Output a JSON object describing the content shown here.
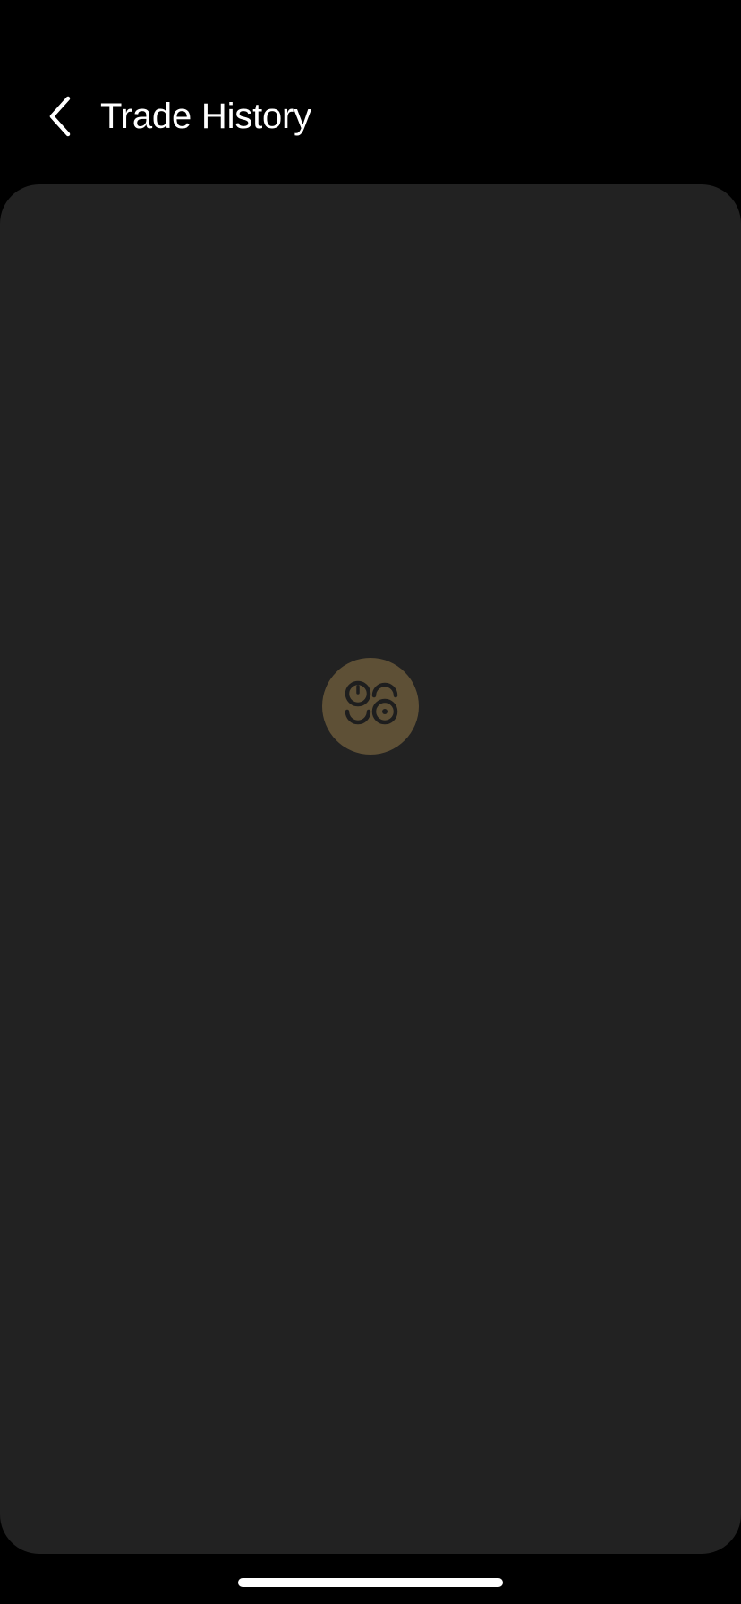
{
  "header": {
    "back_icon": "chevron-left-icon",
    "title": "Trade History"
  },
  "content": {
    "state": "loading",
    "loader_icon": "app-logo-icon",
    "loader_color": "#5e5036",
    "background_color": "#222222"
  },
  "system": {
    "home_indicator_color": "#ffffff"
  }
}
